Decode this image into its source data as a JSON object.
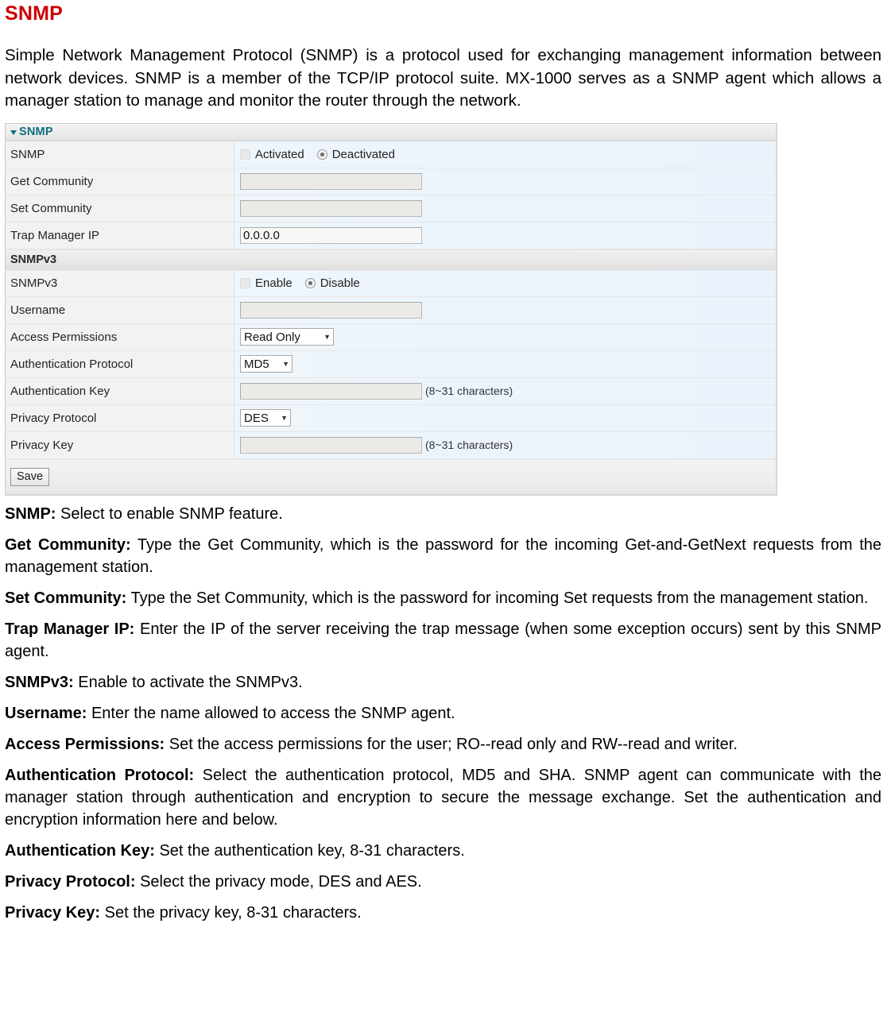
{
  "doc": {
    "title": "SNMP",
    "intro": "Simple Network Management Protocol (SNMP) is a protocol used for exchanging management information between network devices. SNMP is a member of the TCP/IP protocol suite. MX-1000 serves as a SNMP agent which allows a manager station to manage and monitor the router through the network."
  },
  "panel": {
    "header_title": "SNMP",
    "collapse_icon": "triangle-down-icon",
    "accent_color": "#0d6f7c",
    "rows": {
      "snmp": {
        "label": "SNMP",
        "options": [
          {
            "label": "Activated",
            "selected": false
          },
          {
            "label": "Deactivated",
            "selected": true
          }
        ]
      },
      "get_community": {
        "label": "Get Community",
        "value": ""
      },
      "set_community": {
        "label": "Set Community",
        "value": ""
      },
      "trap_manager_ip": {
        "label": "Trap Manager IP",
        "value": "0.0.0.0"
      }
    },
    "subsection": {
      "header": "SNMPv3",
      "rows": {
        "snmpv3": {
          "label": "SNMPv3",
          "options": [
            {
              "label": "Enable",
              "selected": false
            },
            {
              "label": "Disable",
              "selected": true
            }
          ]
        },
        "username": {
          "label": "Username",
          "value": ""
        },
        "access_permissions": {
          "label": "Access Permissions",
          "value": "Read Only"
        },
        "authentication_protocol": {
          "label": "Authentication Protocol",
          "value": "MD5"
        },
        "authentication_key": {
          "label": "Authentication Key",
          "value": "",
          "hint": "(8~31 characters)"
        },
        "privacy_protocol": {
          "label": "Privacy Protocol",
          "value": "DES"
        },
        "privacy_key": {
          "label": "Privacy Key",
          "value": "",
          "hint": "(8~31 characters)"
        }
      }
    },
    "save_label": "Save"
  },
  "descriptions": [
    {
      "term": "SNMP:",
      "text": " Select to enable SNMP feature."
    },
    {
      "term": "Get Community:",
      "text": " Type the Get Community, which is the password for the incoming Get-and-GetNext requests from the management station."
    },
    {
      "term": "Set Community:",
      "text": " Type the Set Community, which is the password for incoming Set requests from the management station."
    },
    {
      "term": "Trap Manager IP:",
      "text": " Enter the IP of the server receiving the trap message (when some exception occurs) sent by this SNMP agent."
    },
    {
      "term": "SNMPv3:",
      "text": " Enable to activate the SNMPv3."
    },
    {
      "term": "Username:",
      "text": " Enter the name allowed to access the SNMP agent."
    },
    {
      "term": "Access Permissions:",
      "text": " Set the access permissions for the user; RO--read only and RW--read and writer."
    },
    {
      "term": "Authentication Protocol:",
      "text": " Select the authentication protocol, MD5 and SHA. SNMP agent can communicate with the manager station through authentication and encryption to secure the message exchange. Set the authentication and encryption information here and below."
    },
    {
      "term": "Authentication Key:",
      "text": " Set the authentication key, 8-31 characters."
    },
    {
      "term": "Privacy Protocol:",
      "text": " Select the privacy mode, DES and AES."
    },
    {
      "term": "Privacy Key:",
      "text": " Set the privacy key, 8-31 characters."
    }
  ]
}
